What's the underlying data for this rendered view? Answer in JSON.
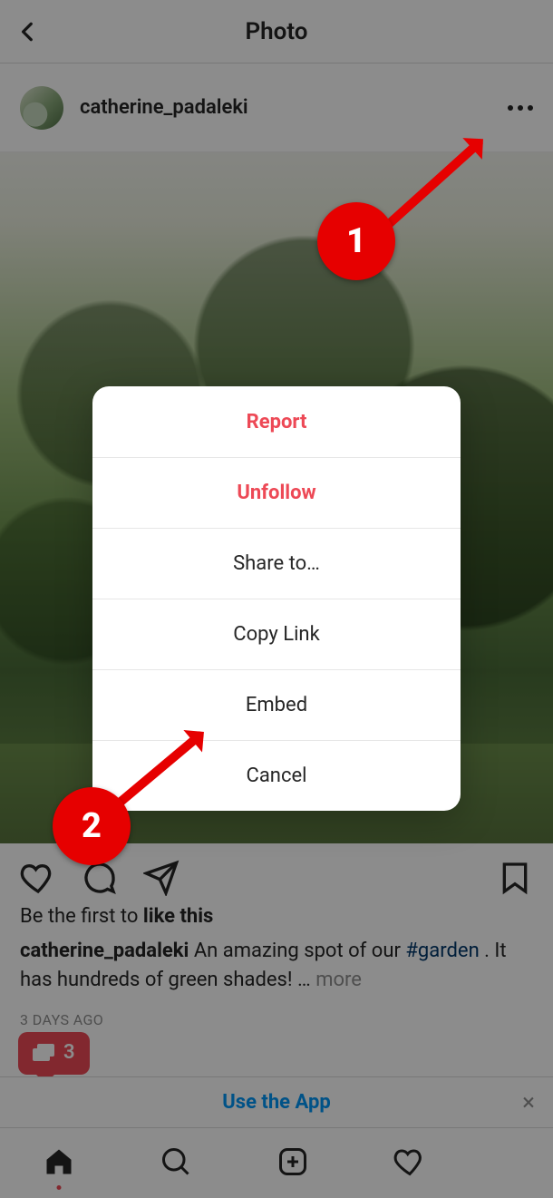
{
  "header": {
    "title": "Photo"
  },
  "post": {
    "username": "catherine_padaleki",
    "likes_prefix": "Be the first to ",
    "likes_emph": "like this",
    "caption_user": "catherine_padaleki",
    "caption_text_1": " An amazing spot of our ",
    "caption_hashtag": "#garden",
    "caption_text_2": " . It has hundreds of green shades! ",
    "caption_ellipsis": "… ",
    "caption_more": "more",
    "timestamp": "3 DAYS AGO"
  },
  "use_app": {
    "label": "Use the App"
  },
  "notif": {
    "count": "3"
  },
  "sheet": {
    "report": "Report",
    "unfollow": "Unfollow",
    "share": "Share to…",
    "copy": "Copy Link",
    "embed": "Embed",
    "cancel": "Cancel"
  },
  "callouts": {
    "one": "1",
    "two": "2"
  }
}
